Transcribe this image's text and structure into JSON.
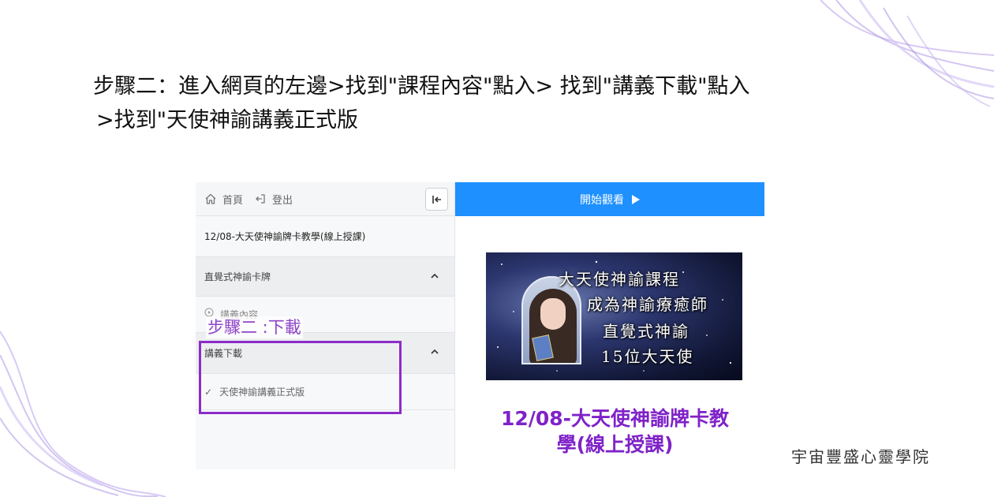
{
  "instruction": {
    "line1": "步驟二：進入網頁的左邊>找到\"課程內容\"點入> 找到\"講義下載\"點入",
    "line2": ">找到\"天使神諭講義正式版"
  },
  "sidebar": {
    "home_label": "首頁",
    "logout_label": "登出",
    "course_title": "12/08-大天使神諭牌卡教學(線上授課)",
    "sections": [
      {
        "label": "直覺式神諭卡牌",
        "lessons": [
          {
            "label": "講義內容"
          }
        ]
      },
      {
        "label": "講義下載",
        "lessons": [
          {
            "label": "天使神諭講義正式版",
            "completed": true
          }
        ]
      }
    ]
  },
  "annotation": {
    "step_label": "步驟二 :下載",
    "color": "#8d2cc9"
  },
  "main": {
    "start_button_label": "開始觀看",
    "button_color": "#1e90ff",
    "banner_lines": [
      "大天使神諭課程",
      "成為神諭療癒師",
      "直覺式神諭",
      "15位大天使"
    ],
    "course_heading_line1": "12/08-大天使神諭牌卡教",
    "course_heading_line2": "學(線上授課)",
    "heading_color": "#7f22c8"
  },
  "footer": {
    "brand": "宇宙豐盛心靈學院"
  },
  "icons": {
    "home": "home-icon",
    "logout": "logout-icon",
    "collapse": "collapse-left-icon",
    "chevron": "chevron-up-icon",
    "play_circle": "play-circle-icon",
    "check": "check-icon",
    "play": "play-triangle-icon"
  }
}
